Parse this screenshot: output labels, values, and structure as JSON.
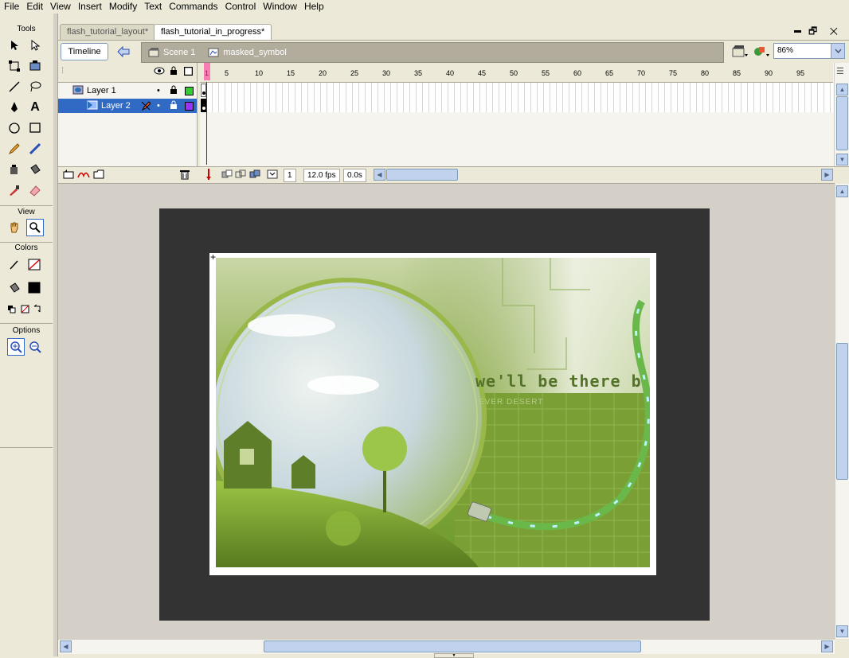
{
  "menu": [
    "File",
    "Edit",
    "View",
    "Insert",
    "Modify",
    "Text",
    "Commands",
    "Control",
    "Window",
    "Help"
  ],
  "tools_panel": {
    "title": "Tools",
    "view_title": "View",
    "colors_title": "Colors",
    "options_title": "Options"
  },
  "doc_tabs": [
    {
      "label": "flash_tutorial_layout*",
      "active": false
    },
    {
      "label": "flash_tutorial_in_progress*",
      "active": true
    }
  ],
  "window_controls": {
    "restore": "🗗",
    "close": "✕",
    "minimize": "▬"
  },
  "editbar": {
    "timeline_button": "Timeline",
    "breadcrumbs": [
      {
        "label": "Scene 1",
        "icon": "scene-icon"
      },
      {
        "label": "masked_symbol",
        "icon": "symbol-icon"
      }
    ],
    "zoom": "86%"
  },
  "timeline": {
    "layers": [
      {
        "name": "Layer 1",
        "selected": false,
        "color": "#33cc33"
      },
      {
        "name": "Layer 2",
        "selected": true,
        "color": "#9933ff"
      }
    ],
    "frame_numbers": [
      "1",
      "5",
      "10",
      "15",
      "20",
      "25",
      "30",
      "35",
      "40",
      "45",
      "50",
      "55",
      "60",
      "65",
      "70",
      "75",
      "80",
      "85",
      "90",
      "95"
    ],
    "current_frame": "1",
    "fps": "12.0 fps",
    "elapsed": "0.0s"
  },
  "artwork": {
    "tagline": "we'll be there b",
    "subtext": "EVER DESERT"
  },
  "colors": {
    "selection": "#316ac5",
    "stage_background": "#333333",
    "pasteboard": "#d4d0c8"
  }
}
